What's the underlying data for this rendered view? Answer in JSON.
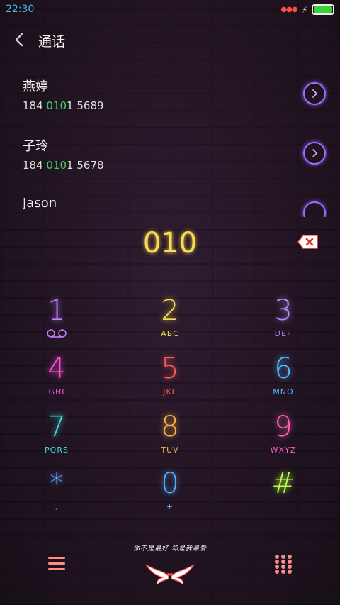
{
  "status": {
    "time": "22:30",
    "battery_level": 1.0
  },
  "header": {
    "title": "通话"
  },
  "contacts": [
    {
      "name": "燕婷",
      "number_prefix": "184 ",
      "number_match": "010",
      "number_suffix": "1 5689"
    },
    {
      "name": "子玲",
      "number_prefix": "184 ",
      "number_match": "010",
      "number_suffix": "1 5678"
    },
    {
      "name": "Jason"
    }
  ],
  "dialer": {
    "input": "010"
  },
  "keys": [
    {
      "digit": "1",
      "letters": "",
      "color": "#c47cff"
    },
    {
      "digit": "2",
      "letters": "ABC",
      "color": "#f3de4c"
    },
    {
      "digit": "3",
      "letters": "DEF",
      "color": "#b58bff"
    },
    {
      "digit": "4",
      "letters": "GHI",
      "color": "#ff4fd6"
    },
    {
      "digit": "5",
      "letters": "JKL",
      "color": "#ff5a55"
    },
    {
      "digit": "6",
      "letters": "MNO",
      "color": "#53b8ff"
    },
    {
      "digit": "7",
      "letters": "PQRS",
      "color": "#3fdbe0"
    },
    {
      "digit": "8",
      "letters": "TUV",
      "color": "#ffb24a"
    },
    {
      "digit": "9",
      "letters": "WXYZ",
      "color": "#ff5fb5"
    },
    {
      "digit": "*",
      "letters": ",",
      "color": "#5aa9ff"
    },
    {
      "digit": "0",
      "letters": "+",
      "color": "#4fb0ff"
    },
    {
      "digit": "#",
      "letters": "",
      "color": "#b7ff44"
    }
  ],
  "bottom": {
    "logo_text": "你不是最好 却是我最爱"
  },
  "icons": {
    "back": "chevron-left-icon",
    "contact_action": "chevron-right-icon",
    "delete": "backspace-icon",
    "voicemail": "voicemail-icon",
    "menu": "menu-icon",
    "dialpad": "dialpad-icon",
    "logo": "doves-icon"
  },
  "colors": {
    "status_time": "#49b7ee",
    "highlight": "#3ed35a",
    "accent": "#9c6dff"
  }
}
